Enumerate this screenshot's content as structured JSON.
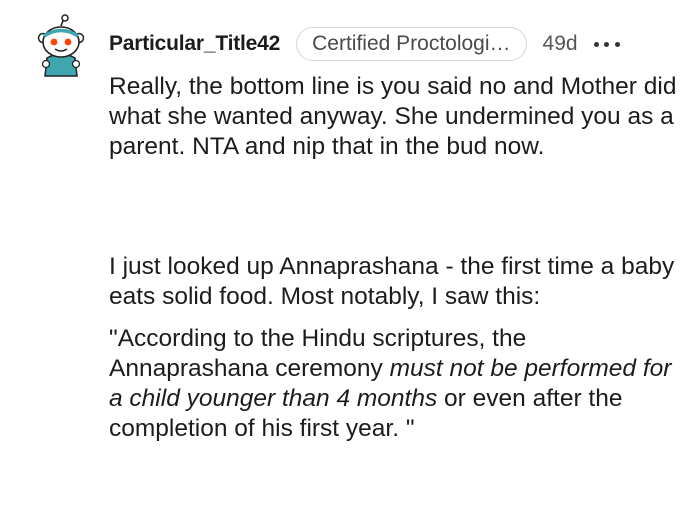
{
  "comment": {
    "username": "Particular_Title42",
    "flair": "Certified Proctologi…",
    "timestamp": "49d",
    "avatar_icon": "snoo-avatar-icon",
    "more_icon": "more-options-icon",
    "paragraphs": {
      "p1": "Really, the bottom line is you said no and Mother did what she wanted anyway. She undermined you as a parent. NTA and nip that in the bud now.",
      "p2": "I just looked up Annaprashana - the first time a baby eats solid food. Most notably, I saw this:",
      "p3_part1": "\"According to the Hindu scriptures, the Annaprashana ceremony ",
      "p3_italic": "must not be performed for a child younger than 4 months",
      "p3_part2": " or even after the completion of his first year. \""
    }
  },
  "colors": {
    "text": "#1c1c1c",
    "meta": "#565656",
    "flair_border": "#d5d6d8",
    "avatar_accent": "#3fa6b0"
  }
}
